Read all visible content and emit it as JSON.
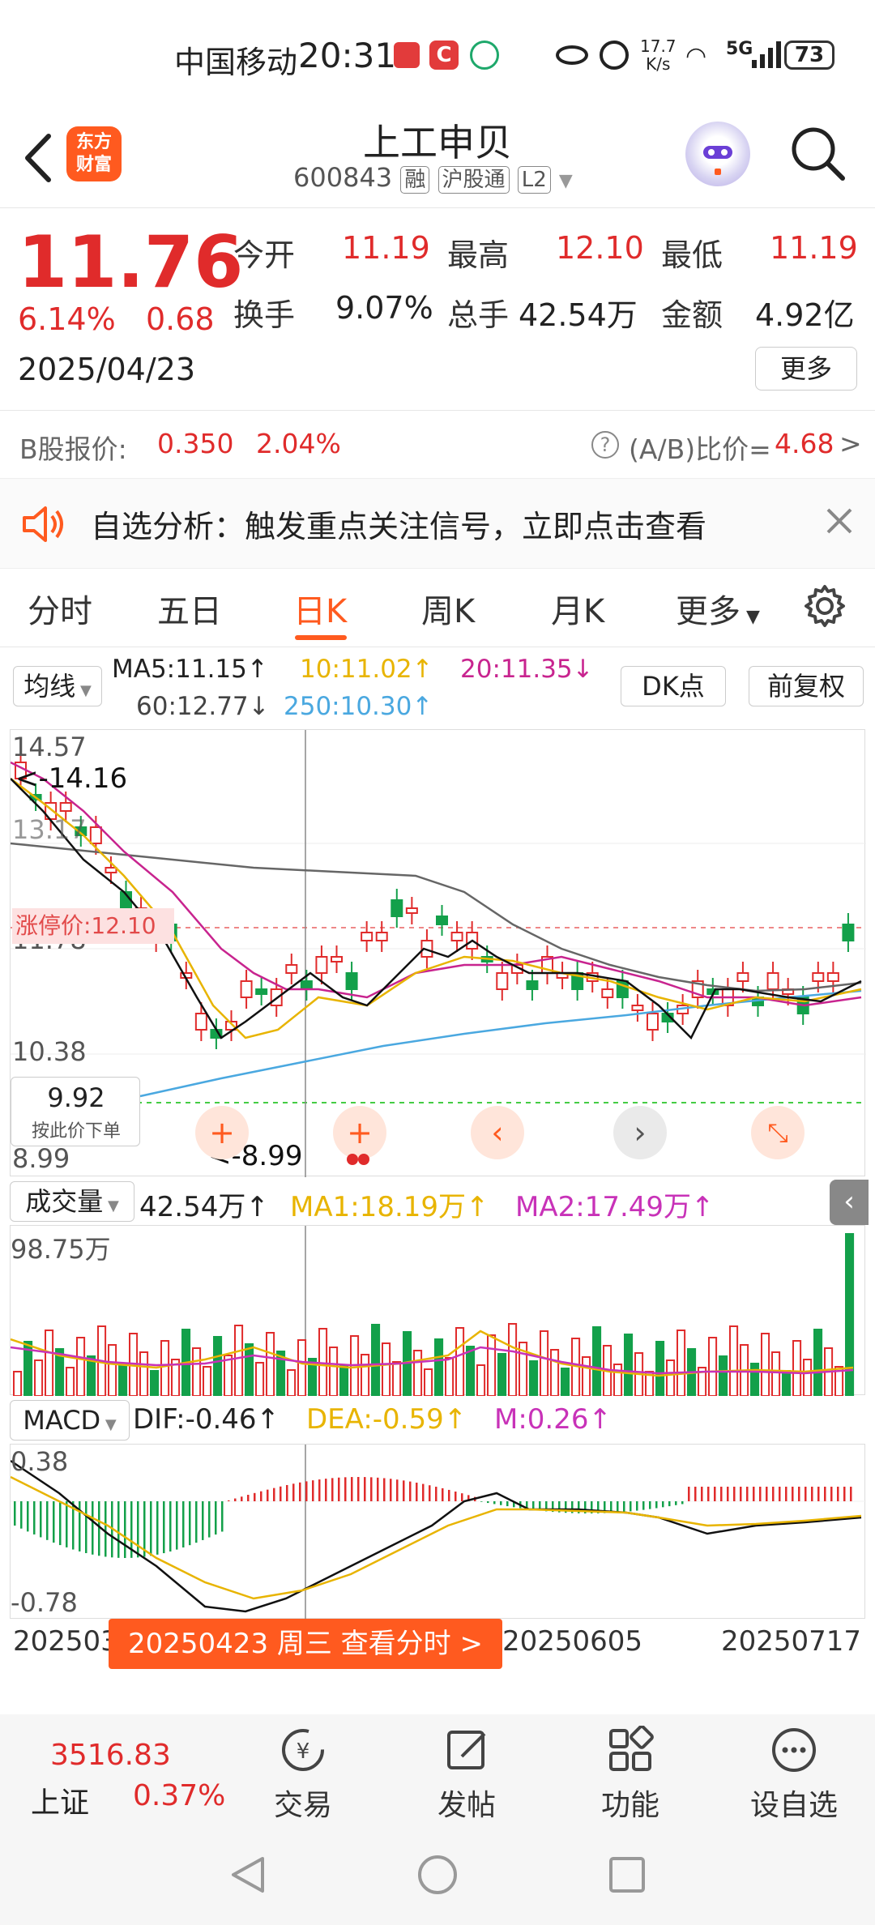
{
  "status_bar": {
    "carrier": "中国移动",
    "time": "20:31",
    "net_speed": "17.7\nK/s",
    "signal": "5G",
    "battery": "73"
  },
  "header": {
    "logo_text": "东方\n财富",
    "stock_name": "上工申贝",
    "code": "600843",
    "tags": [
      "融",
      "沪股通",
      "L2"
    ]
  },
  "quote": {
    "price": "11.76",
    "change_pct": "6.14%",
    "change": "0.68",
    "date": "2025/04/23",
    "open_label": "今开",
    "open": "11.19",
    "high_label": "最高",
    "high": "12.10",
    "low_label": "最低",
    "low": "11.19",
    "turnover_label": "换手",
    "turnover": "9.07%",
    "volume_label": "总手",
    "volume": "42.54万",
    "amount_label": "金额",
    "amount": "4.92亿",
    "more": "更多"
  },
  "bshare": {
    "label": "B股报价:",
    "price": "0.350",
    "pct": "2.04%",
    "ratio_label": "(A/B)比价=",
    "ratio": "4.68",
    "arrow": ">"
  },
  "notice": {
    "text": "自选分析：触发重点关注信号，立即点击查看"
  },
  "tabs": [
    "分时",
    "五日",
    "日K",
    "周K",
    "月K",
    "更多"
  ],
  "ma_bar": {
    "selector": "均线",
    "ma5": "MA5:11.15↑",
    "ma10": "10:11.02↑",
    "ma20": "20:11.35↓",
    "ma60": "60:12.77↓",
    "ma250": "250:10.30↑",
    "dk_button": "DK点",
    "fq_button": "前复权"
  },
  "kchart": {
    "y_labels": [
      "14.57",
      "13.17",
      "11.78",
      "10.38",
      "8.99"
    ],
    "max_mark": "<-14.16",
    "min_mark": "<-8.99",
    "limit_label": "涨停价:12.10",
    "order_price": "9.92",
    "order_label": "按此价下单"
  },
  "volume": {
    "selector": "成交量",
    "value": "42.54万↑",
    "ma1": "MA1:18.19万↑",
    "ma2": "MA2:17.49万↑",
    "y_max": "98.75万"
  },
  "macd": {
    "selector": "MACD",
    "dif": "DIF:-0.46↑",
    "dea": "DEA:-0.59↑",
    "m": "M:0.26↑",
    "y_top": "0.38",
    "y_bottom": "-0.78"
  },
  "x_axis": {
    "start": "2025030",
    "mid": "20250605",
    "end": "20250717",
    "tooltip": "20250423 周三 查看分时 >"
  },
  "bottom_nav": {
    "index_value": "3516.83",
    "index_name": "上证",
    "index_pct": "0.37%",
    "items": [
      "交易",
      "发帖",
      "功能",
      "设自选"
    ]
  },
  "colors": {
    "up": "#e02b2b",
    "down": "#13a04a",
    "accent": "#ff5a1f",
    "ma5": "#000000",
    "ma10": "#e8b400",
    "ma20": "#c8248f",
    "ma60": "#666666",
    "ma250": "#4aa8e0"
  },
  "icons": [
    "back-icon",
    "robot-avatar-icon",
    "search-icon",
    "speaker-icon",
    "close-icon",
    "settings-icon",
    "trade-icon",
    "post-icon",
    "function-icon",
    "add-watch-icon"
  ]
}
